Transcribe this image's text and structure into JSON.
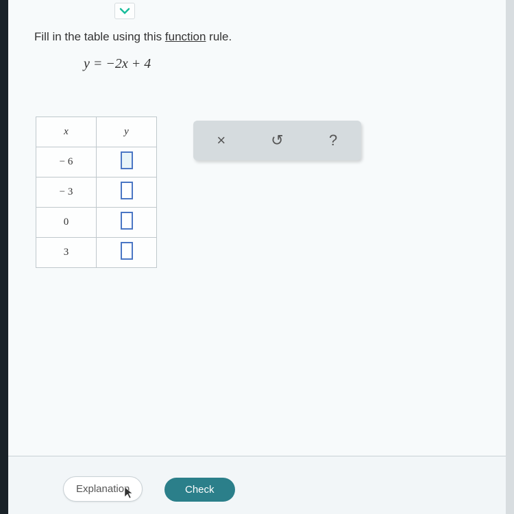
{
  "instruction": {
    "prefix": "Fill in the table using this ",
    "link_word": "function",
    "suffix": " rule."
  },
  "equation": "y = −2x + 4",
  "table": {
    "header_x": "x",
    "header_y": "y",
    "rows": [
      {
        "x": "− 6",
        "y": "",
        "active": true
      },
      {
        "x": "− 3",
        "y": "",
        "active": false
      },
      {
        "x": "0",
        "y": "",
        "active": false
      },
      {
        "x": "3",
        "y": "",
        "active": false
      }
    ]
  },
  "toolbar": {
    "clear_icon": "×",
    "undo_icon": "↺",
    "help_icon": "?"
  },
  "footer": {
    "explanation_label": "Explanation",
    "check_label": "Check"
  },
  "chart_data": {
    "type": "table",
    "title": "Function table for y = -2x + 4",
    "columns": [
      "x",
      "y"
    ],
    "rows": [
      [
        -6,
        null
      ],
      [
        -3,
        null
      ],
      [
        0,
        null
      ],
      [
        3,
        null
      ]
    ],
    "rule": "y = -2x + 4"
  }
}
